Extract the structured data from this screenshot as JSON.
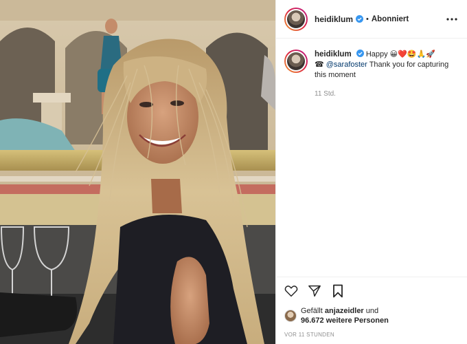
{
  "post": {
    "author": {
      "username": "heidiklum",
      "verified_icon": "verified-badge-icon",
      "follow_separator": "•",
      "follow_status": "Abonniert"
    },
    "more_icon": "more-options-icon",
    "caption": {
      "username": "heidiklum",
      "text_start": "Happy",
      "emojis": "😀❤️🤩🙏🚀",
      "line2_icon": "☎",
      "mention": "@sarafoster",
      "text_end": " Thank you for capturing this moment",
      "relative_time": "11 Std."
    },
    "actions": {
      "like_icon": "heart-icon",
      "share_icon": "paper-plane-icon",
      "save_icon": "bookmark-icon"
    },
    "likes": {
      "prefix": "Gefällt ",
      "first_liker": "anjazeidler",
      "connector": " und",
      "count_text": "96.672 weitere Personen"
    },
    "timestamp": "VOR 11 STUNDEN"
  },
  "colors": {
    "link": "#00376b",
    "muted": "#8e8e8e",
    "verified": "#3897f0",
    "border": "#efefef"
  }
}
